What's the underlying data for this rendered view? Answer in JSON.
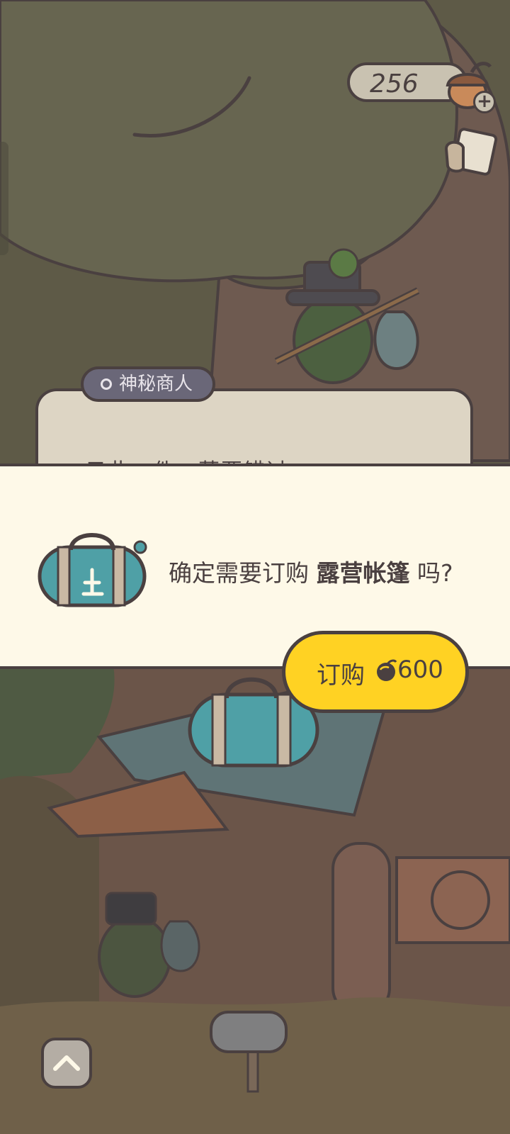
{
  "top_bar": {
    "acorn_count": "256",
    "acorn_icon": "acorn-icon",
    "add_icon": "plus-icon",
    "photo_icon": "photo-album-icon"
  },
  "merchant_dialog": {
    "tag_label": "神秘商人",
    "partial_text": "只此一件，莫要错过"
  },
  "confirm_dialog": {
    "prefix": "确定需要订购 ",
    "item_name": "露营帐篷",
    "suffix": " 吗?",
    "item_icon": "duffel-bag-icon"
  },
  "buy_button": {
    "label": "订购",
    "price": "600",
    "currency_icon": "acorn-icon"
  },
  "bottom_bar": {
    "expand_icon": "chevron-up-icon"
  },
  "colors": {
    "outline": "#4a4040",
    "panel_bg": "#fef9e8",
    "button_yellow": "#ffd223",
    "tag_purple": "#6a6778",
    "tree_green": "#5e5a47"
  }
}
